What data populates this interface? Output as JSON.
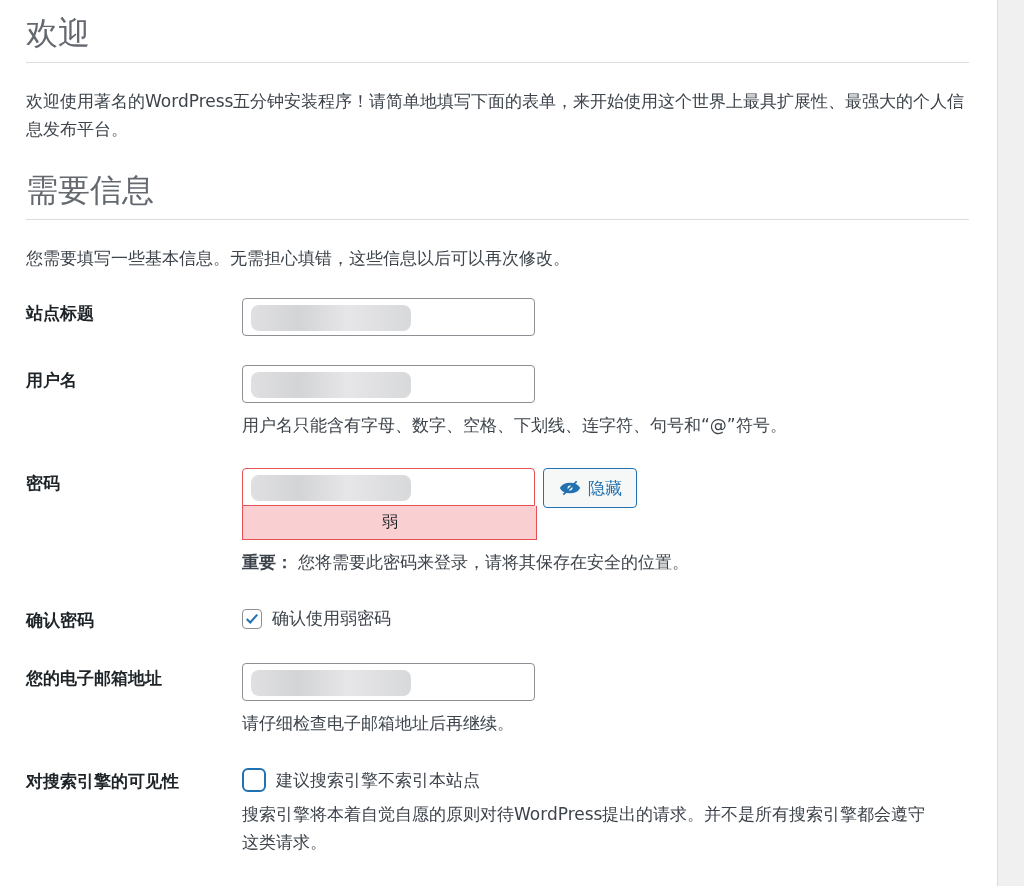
{
  "sections": [
    {
      "heading": "欢迎",
      "intro": "欢迎使用著名的WordPress五分钟安装程序！请简单地填写下面的表单，来开始使用这个世界上最具扩展性、最强大的个人信息发布平台。"
    },
    {
      "heading": "需要信息",
      "intro": "您需要填写一些基本信息。无需担心填错，这些信息以后可以再次修改。"
    }
  ],
  "form": [
    {
      "kind": "text",
      "label": "站点标题",
      "redacted": true
    },
    {
      "kind": "text",
      "label": "用户名",
      "redacted": true,
      "hint": "用户名只能含有字母、数字、空格、下划线、连字符、句号和“@”符号。"
    },
    {
      "kind": "password",
      "label": "密码",
      "redacted": true,
      "toggle": "隐藏",
      "strength": {
        "label": "弱",
        "kind": "weak"
      },
      "hint": "**重要：** 您将需要此密码来登录，请将其保存在安全的位置。"
    },
    {
      "kind": "checkbox",
      "label": "确认密码",
      "option": "确认使用弱密码",
      "checked": true
    },
    {
      "kind": "text",
      "label": "您的电子邮箱地址",
      "redacted": true,
      "hint": "请仔细检查电子邮箱地址后再继续。"
    },
    {
      "kind": "checkbox",
      "label": "对搜索引擎的可见性",
      "option": "建议搜索引擎不索引本站点",
      "checked": false,
      "hint": "搜索引擎将本着自觉自愿的原则对待WordPress提出的请求。并不是所有搜索引擎都会遵守这类请求。"
    }
  ]
}
